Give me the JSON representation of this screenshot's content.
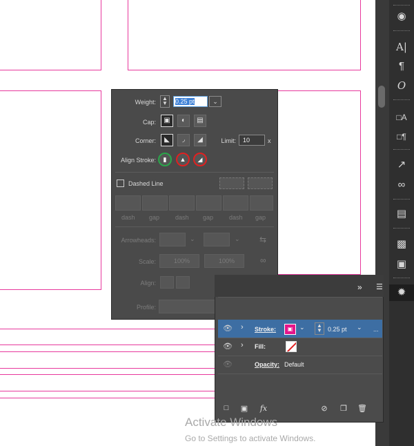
{
  "stroke_panel": {
    "weight_label": "Weight:",
    "weight_value": "0.25 pt",
    "cap_label": "Cap:",
    "corner_label": "Corner:",
    "limit_label": "Limit:",
    "limit_value": "10",
    "limit_unit": "x",
    "align_stroke_label": "Align Stroke:",
    "dashed_line_label": "Dashed Line",
    "dash_labels": [
      "dash",
      "gap",
      "dash",
      "gap",
      "dash",
      "gap"
    ],
    "arrowheads_label": "Arrowheads:",
    "scale_label": "Scale:",
    "scale_start": "100%",
    "scale_end": "100%",
    "align_label": "Align:",
    "profile_label": "Profile:"
  },
  "appearance_panel": {
    "collapse_glyph": "»",
    "stroke_label": "Stroke:",
    "stroke_weight": "0.25 pt",
    "fill_label": "Fill:",
    "opacity_label": "Opacity:",
    "opacity_value": "Default",
    "more_glyph": "..."
  },
  "watermark": {
    "title": "Activate Windows",
    "subtitle": "Go to Settings to activate Windows."
  },
  "colors": {
    "stroke_swatch": "#e4158a",
    "guide_lines": "#e7379c",
    "align_center_ring": "#2aa64a",
    "align_other_rings": "#e02020"
  },
  "toolbar": {
    "icons": [
      "creative-cloud-libraries-icon",
      "character-icon",
      "paragraph-icon",
      "opentype-icon",
      "character-styles-icon",
      "paragraph-styles-icon",
      "export-icon",
      "links-icon",
      "asset-export-icon",
      "artboards-icon",
      "transform-icon",
      "appearance-icon"
    ]
  }
}
